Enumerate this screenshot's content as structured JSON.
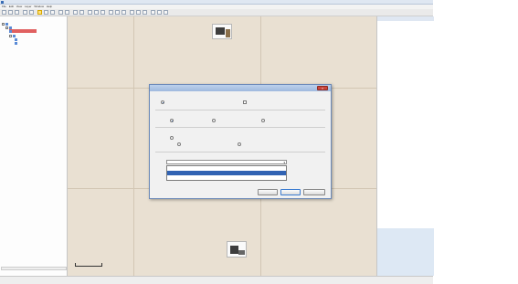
{
  "window": {
    "title": ""
  },
  "menu": [
    "File",
    "Edit",
    "View",
    "Layer",
    "Window",
    "Help"
  ],
  "toolbar_icons": [
    "new-icon",
    "open-icon",
    "save-icon",
    "undo-icon",
    "redo-icon",
    "zoom-in-icon",
    "zoom-out-icon",
    "pan-icon",
    "select-icon",
    "measure-icon"
  ],
  "left_panel": {
    "title": "",
    "tree": [
      {
        "label": ""
      },
      {
        "label": ""
      },
      {
        "label": ""
      },
      {
        "label": ""
      },
      {
        "label": ""
      },
      {
        "label": ""
      }
    ],
    "tabs": [
      "",
      "",
      ""
    ]
  },
  "map": {
    "coords_top": [
      "",
      ""
    ],
    "coords_left": [
      "",
      ""
    ],
    "coords_right": [
      "",
      ""
    ],
    "coords_bottom": [
      "",
      ""
    ],
    "scale_label": ""
  },
  "right_panel": {
    "title": "",
    "properties": [
      {
        "name": "",
        "value": ""
      },
      {
        "name": "",
        "value": ""
      }
    ]
  },
  "dialog": {
    "title": "",
    "section_layers": "",
    "opt_all_layers": "",
    "opt_visible_layers": "",
    "section_geometry": "",
    "geom_point": "",
    "geom_line": "",
    "geom_polygon": "",
    "section_merge": "",
    "merge_opt1": "",
    "merge_opt2": "",
    "merge_opt3": "",
    "section_crs": "",
    "crs_selected": "",
    "crs_options": [
      "",
      "",
      ""
    ],
    "btn_back": "",
    "btn_next": "",
    "btn_cancel": ""
  }
}
